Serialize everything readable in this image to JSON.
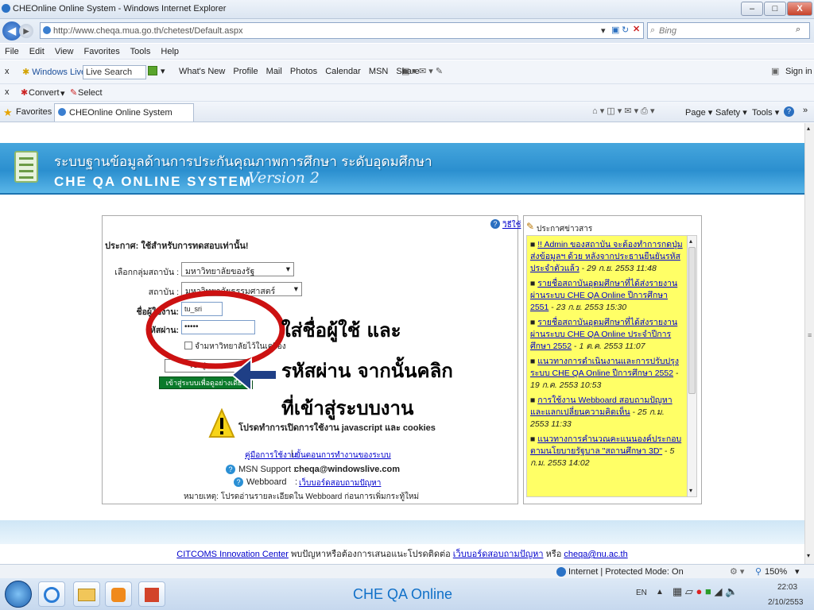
{
  "window": {
    "title": "CHEOnline Online System - Windows Internet Explorer",
    "min": "–",
    "max": "□",
    "close": "X"
  },
  "address": {
    "url": "http://www.cheqa.mua.go.th/chetest/Default.aspx",
    "search_placeholder": "Bing"
  },
  "menu": [
    "File",
    "Edit",
    "View",
    "Favorites",
    "Tools",
    "Help"
  ],
  "livebar": {
    "brand": "Windows Live",
    "search_placeholder": "Live Search",
    "links": [
      "What's New",
      "Profile",
      "Mail",
      "Photos",
      "Calendar",
      "MSN",
      "Share"
    ],
    "signin": "Sign in"
  },
  "convbar": {
    "convert": "Convert",
    "select": "Select"
  },
  "favbar": {
    "favorites": "Favorites",
    "tab": "CHEOnline Online System",
    "tools": [
      "Page ▾",
      "Safety ▾",
      "Tools ▾"
    ]
  },
  "banner": {
    "thai": "ระบบฐานข้อมูลด้านการประกันคุณภาพการศึกษา ระดับอุดมศึกษา",
    "english": "CHE QA ONLINE SYSTEM",
    "version": "Version 2"
  },
  "login": {
    "help": "วิธีใช้",
    "notice": "ประกาศ: ใช้สำหรับการทดสอบเท่านั้น!",
    "group_label": "เลือกกลุ่มสถาบัน :",
    "group_value": "มหาวิทยาลัยของรัฐ",
    "inst_label": "สถาบัน :",
    "inst_value": "มหาวิทยาลัยธรรมศาสตร์",
    "user_label": "ชื่อผู้ใช้งาน:",
    "user_value": "tu_sri",
    "pass_label": "รหัสผ่าน:",
    "pass_value": "•••••",
    "remember": "จำมหาวิทยาลัยไว้ในเครื่อง",
    "login_btn": "เข้าสู่ระบบ",
    "view_btn": "เข้าสู่ระบบเพื่อดูอย่างเดียว",
    "warning": "โปรดทำการเปิดการใช้งาน javascript และ cookies",
    "manual": "คู่มือการใช้งาน",
    "steps": "ขั้นตอนการทำงานของระบบ",
    "msn_label": "MSN Support :",
    "msn_value": "cheqa@windowslive.com",
    "webboard_label": "Webboard",
    "webboard_value": "เว็บบอร์ดสอบถามปัญหา",
    "note": "หมายเหตุ: โปรดอ่านรายละเอียดใน Webboard ก่อนการเพิ่มกระทู้ใหม่"
  },
  "annotation": {
    "line1": "ใส่ชื่อผู้ใช้ และ",
    "line2": "รหัสผ่าน จากนั้นคลิก",
    "line3": "ที่เข้าสู่ระบบงาน"
  },
  "news": {
    "title": "ประกาศข่าวสาร",
    "items": [
      {
        "text": "!! Admin ของสถาบัน จะต้องทำการกดปุ่มส่งข้อมูลฯ ด้วย หลังจากประธานยืนยันรหัสประจำตัวแล้ว",
        "date": "29 ก.ย. 2553 11:48"
      },
      {
        "text": "รายชื่อสถาบันอุดมศึกษาที่ได้ส่งรายงานผ่านระบบ CHE QA Online ปีการศึกษา 2551",
        "date": "23 ก.ย. 2553 15:30"
      },
      {
        "text": "รายชื่อสถาบันอุดมศึกษาที่ได้ส่งรายงานผ่านระบบ CHE QA Online ประจำปีการศึกษา 2552",
        "date": "1 ต.ค. 2553 11:07"
      },
      {
        "text": "แนวทางการดำเนินงานและการปรับปรุงระบบ CHE QA Online ปีการศึกษา 2552",
        "date": "19 ก.ค. 2553 10:53"
      },
      {
        "text": "การใช้งาน Webboard สอบถามปัญหาและแลกเปลี่ยนความคิดเห็น",
        "date": "25 ก.ม. 2553 11:33"
      },
      {
        "text": "แนวทางการคำนวณคะแนนองค์ประกอบตามนโยบายรัฐบาล \"สถานศึกษา 3D\"",
        "date": "5 ก.ม. 2553 14:02"
      }
    ]
  },
  "footer": {
    "center": "CITCOMS Innovation Center",
    "text": " พบปัญหาหรือต้องการเสนอแนะโปรดติดต่อ ",
    "webboard": "เว็บบอร์ดสอบถามปัญหา",
    "or": " หรือ ",
    "email": "cheqa@nu.ac.th"
  },
  "status": {
    "zone": "Internet | Protected Mode: On",
    "zoom": "150%"
  },
  "taskbar": {
    "caption": "CHE QA Online",
    "lang": "EN",
    "time": "22:03",
    "date": "2/10/2553"
  },
  "colors": {
    "banner": "#2b8fcf",
    "news_bg": "#ffff66",
    "link": "#0000cc",
    "annotation_circle": "#cc1111"
  }
}
